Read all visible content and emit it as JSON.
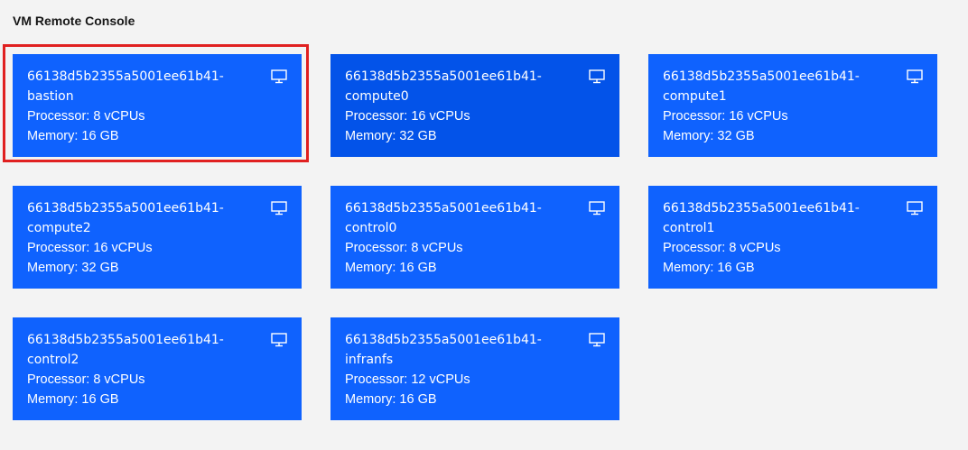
{
  "page": {
    "title": "VM Remote Console"
  },
  "vms": [
    {
      "name_line1": "66138d5b2355a5001ee61b41-",
      "name_line2": "bastion",
      "processor": "Processor: 8 vCPUs",
      "memory": "Memory: 16 GB",
      "icon": "monitor-icon"
    },
    {
      "name_line1": "66138d5b2355a5001ee61b41-",
      "name_line2": "compute0",
      "processor": "Processor: 16 vCPUs",
      "memory": "Memory: 32 GB",
      "icon": "monitor-icon"
    },
    {
      "name_line1": "66138d5b2355a5001ee61b41-",
      "name_line2": "compute1",
      "processor": "Processor: 16 vCPUs",
      "memory": "Memory: 32 GB",
      "icon": "monitor-icon"
    },
    {
      "name_line1": "66138d5b2355a5001ee61b41-",
      "name_line2": "compute2",
      "processor": "Processor: 16 vCPUs",
      "memory": "Memory: 32 GB",
      "icon": "monitor-icon"
    },
    {
      "name_line1": "66138d5b2355a5001ee61b41-",
      "name_line2": "control0",
      "processor": "Processor: 8 vCPUs",
      "memory": "Memory: 16 GB",
      "icon": "monitor-icon"
    },
    {
      "name_line1": "66138d5b2355a5001ee61b41-",
      "name_line2": "control1",
      "processor": "Processor: 8 vCPUs",
      "memory": "Memory: 16 GB",
      "icon": "monitor-icon"
    },
    {
      "name_line1": "66138d5b2355a5001ee61b41-",
      "name_line2": "control2",
      "processor": "Processor: 8 vCPUs",
      "memory": "Memory: 16 GB",
      "icon": "monitor-icon"
    },
    {
      "name_line1": "66138d5b2355a5001ee61b41-",
      "name_line2": "infranfs",
      "processor": "Processor: 12 vCPUs",
      "memory": "Memory: 16 GB",
      "icon": "monitor-icon"
    }
  ],
  "colors": {
    "tile": "#0f62fe",
    "tile_hover": "#0353e9",
    "highlight": "#e02020",
    "background": "#f3f3f3"
  }
}
